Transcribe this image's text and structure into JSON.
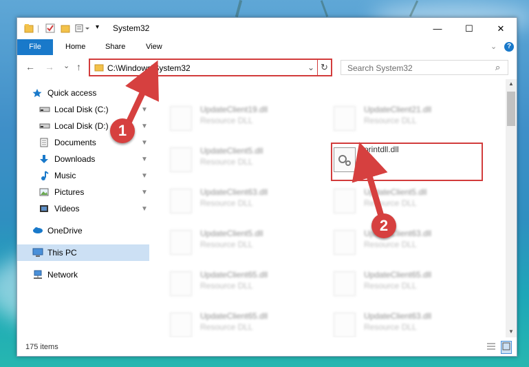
{
  "titlebar": {
    "title": "System32",
    "minimize": "—",
    "maximize": "☐",
    "close": "✕"
  },
  "ribbon": {
    "tabs": [
      "File",
      "Home",
      "Share",
      "View"
    ],
    "collapse": "⌄",
    "help": "?"
  },
  "address": {
    "back": "←",
    "forward": "→",
    "recent": "⌄",
    "up": "↑",
    "path": "C:\\Windows\\System32",
    "dropdown": "⌄",
    "refresh": "↻",
    "search_placeholder": "Search System32",
    "search_icon": "⌕"
  },
  "nav": {
    "items": [
      {
        "label": "Quick access",
        "icon": "star-icon"
      },
      {
        "label": "Local Disk (C:)",
        "icon": "drive-icon",
        "pinned": true
      },
      {
        "label": "Local Disk (D:)",
        "icon": "drive-icon",
        "pinned": true
      },
      {
        "label": "Documents",
        "icon": "documents-icon",
        "pinned": true
      },
      {
        "label": "Downloads",
        "icon": "download-icon",
        "pinned": true
      },
      {
        "label": "Music",
        "icon": "music-icon",
        "pinned": true
      },
      {
        "label": "Pictures",
        "icon": "pictures-icon",
        "pinned": true
      },
      {
        "label": "Videos",
        "icon": "videos-icon",
        "pinned": true
      },
      {
        "label": "OneDrive",
        "icon": "cloud-icon"
      },
      {
        "label": "This PC",
        "icon": "computer-icon",
        "selected": true
      },
      {
        "label": "Network",
        "icon": "network-icon"
      }
    ],
    "pin_glyph": "📌"
  },
  "files": {
    "left": [
      {
        "name": "UpdateClient19.dll",
        "desc": "Resource DLL"
      },
      {
        "name": "UpdateClient5.dll",
        "desc": "Resource DLL"
      },
      {
        "name": "UpdateClient63.dll",
        "desc": "Resource DLL"
      },
      {
        "name": "UpdateClient5.dll",
        "desc": "Resource DLL"
      },
      {
        "name": "UpdateClient65.dll",
        "desc": "Resource DLL"
      },
      {
        "name": "UpdateClient65.dll",
        "desc": "Resource DLL"
      }
    ],
    "right": [
      {
        "name": "UpdateClient21.dll",
        "desc": "Resource DLL"
      },
      {
        "name": "printdll.dll",
        "desc": "",
        "highlighted": true
      },
      {
        "name": "UpdateClient5.dll",
        "desc": "Resource DLL"
      },
      {
        "name": "UpdateClient63.dll",
        "desc": "Resource DLL"
      },
      {
        "name": "UpdateClient65.dll",
        "desc": "Resource DLL"
      },
      {
        "name": "UpdateClient63.dll",
        "desc": "Resource DLL"
      }
    ]
  },
  "status": {
    "items_count": "175 items"
  },
  "callouts": {
    "one": "1",
    "two": "2"
  },
  "colors": {
    "accent": "#1979ca",
    "highlight": "#d23b3b",
    "selection": "#cce0f4"
  }
}
